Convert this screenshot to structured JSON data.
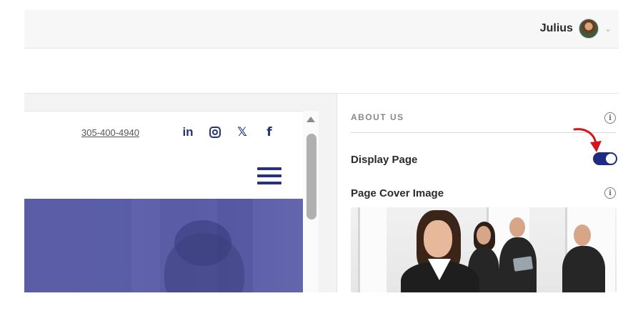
{
  "header": {
    "user_name": "Julius",
    "avatar_icon": "user-avatar",
    "menu_icon": "chevron-down-icon"
  },
  "preview": {
    "phone": "305-400-4940",
    "social": [
      {
        "name": "linkedin",
        "glyph": "in"
      },
      {
        "name": "instagram",
        "glyph": ""
      },
      {
        "name": "x",
        "glyph": "𝕏"
      },
      {
        "name": "facebook",
        "glyph": "f"
      }
    ],
    "menu_icon": "hamburger-icon"
  },
  "panel": {
    "section_title": "ABOUT US",
    "display_page": {
      "label": "Display Page",
      "enabled": true
    },
    "cover_image": {
      "label": "Page Cover Image"
    }
  },
  "colors": {
    "brand": "#27327a",
    "toggle_on": "#1e2a84",
    "hero_overlay": "#5b5ea7",
    "pointer_arrow": "#d2161c"
  }
}
